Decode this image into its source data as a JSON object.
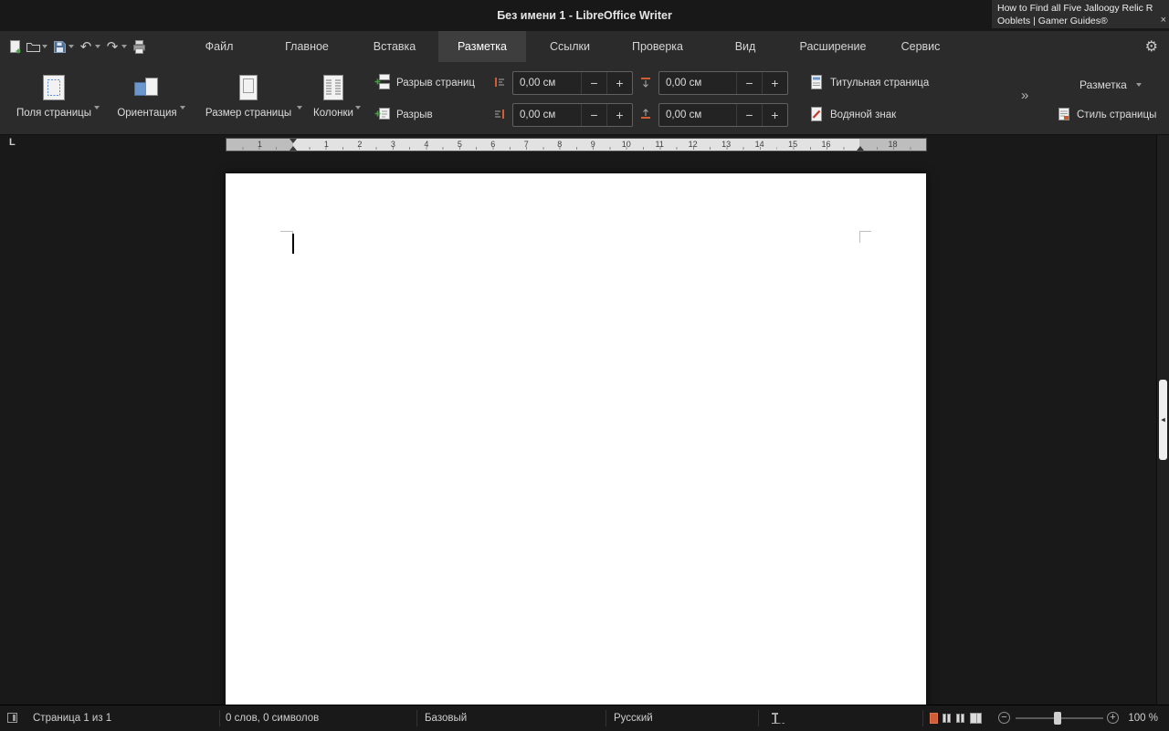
{
  "window": {
    "title": "Без имени 1 - LibreOffice Writer"
  },
  "notification": {
    "line1": "How to Find all Five Jalloogy Relic R",
    "line2": "Ooblets | Gamer Guides®",
    "close": "×"
  },
  "icons": {
    "undo": "↶",
    "redo": "↷",
    "gear": "⚙",
    "overflow": "»",
    "sidebar_collapse": "◂"
  },
  "tabs": {
    "items": [
      "Файл",
      "Главное",
      "Вставка",
      "Разметка",
      "Ссылки",
      "Проверка",
      "Вид",
      "Расширение",
      "Сервис"
    ],
    "active": "Разметка"
  },
  "ribbon": {
    "page_margins": "Поля страницы",
    "orientation": "Ориентация",
    "page_size": "Размер страницы",
    "columns": "Колонки",
    "page_break": "Разрыв страниц",
    "break": "Разрыв",
    "indent_before": "0,00 см",
    "indent_after": "0,00 см",
    "spacing_above": "0,00 см",
    "spacing_below": "0,00 см",
    "minus": "−",
    "plus": "+",
    "title_page": "Титульная страница",
    "watermark": "Водяной знак",
    "layout_select": "Разметка",
    "page_style": "Стиль страницы"
  },
  "ruler": {
    "tab_marker": "L",
    "cells": [
      "",
      "1",
      "",
      "1",
      "2",
      "3",
      "4",
      "5",
      "6",
      "7",
      "8",
      "9",
      "10",
      "11",
      "12",
      "13",
      "14",
      "15",
      "16",
      "",
      "18"
    ]
  },
  "statusbar": {
    "page_info": "Страница 1 из 1",
    "word_count": "0 слов, 0 символов",
    "page_style": "Базовый",
    "language": "Русский",
    "zoom_out": "−",
    "zoom_in": "+",
    "zoom_level": "100 %"
  }
}
